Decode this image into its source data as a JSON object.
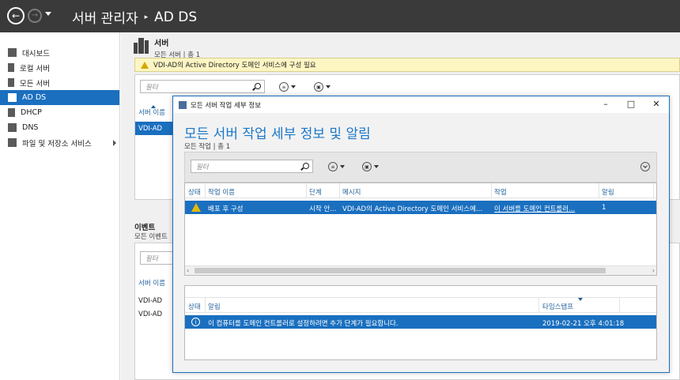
{
  "titlebar": {
    "breadcrumb_app": "서버 관리자",
    "breadcrumb_page": "AD DS"
  },
  "sidebar": {
    "items": [
      {
        "label": "대시보드",
        "icon": "dashboard-icon"
      },
      {
        "label": "로컬 서버",
        "icon": "local-server-icon"
      },
      {
        "label": "모든 서버",
        "icon": "all-servers-icon"
      },
      {
        "label": "AD DS",
        "icon": "ad-ds-icon",
        "active": true
      },
      {
        "label": "DHCP",
        "icon": "dhcp-icon"
      },
      {
        "label": "DNS",
        "icon": "dns-icon"
      },
      {
        "label": "파일 및 저장소 서비스",
        "icon": "file-storage-icon"
      }
    ]
  },
  "servers": {
    "title": "서버",
    "subtitle": "모든 서버 | 총 1",
    "warning": "VDI-AD의 Active Directory 도메인 서비스에 구성 필요",
    "filter_placeholder": "필터",
    "col_server_name": "서버 이름",
    "row_server": "VDI-AD"
  },
  "events": {
    "title": "이벤트",
    "subtitle": "모든 이벤트",
    "filter_placeholder": "필터",
    "col_server_name": "서버 이름",
    "rows": [
      "VDI-AD",
      "VDI-AD"
    ]
  },
  "dialog": {
    "window_title": "모든 서버 작업 세부 정보",
    "heading": "모든 서버 작업 세부 정보 및 알림",
    "subtitle": "모든 작업 | 총 1",
    "filter_placeholder": "필터",
    "tasks": {
      "headers": {
        "status": "상태",
        "task_name": "작업 이름",
        "stage": "단계",
        "message": "메시지",
        "action": "작업",
        "notifications": "알림"
      },
      "row": {
        "task_name": "배포 후 구성",
        "stage": "시작 안...",
        "message": "VDI-AD의 Active Directory 도메인 서비스에...",
        "action": "이 서버를 도메인 컨트롤러...",
        "notifications": "1"
      }
    },
    "notifications": {
      "headers": {
        "status": "상태",
        "notification": "알림",
        "timestamp": "타임스탬프"
      },
      "row": {
        "message": "이 컴퓨터를 도메인 컨트롤러로 설정하려면 추가 단계가 필요합니다.",
        "timestamp": "2019-02-21 오후 4:01:18"
      }
    }
  },
  "colors": {
    "accent": "#1a6fbf",
    "titlebar": "#3a3a3a",
    "heading_blue": "#1a77c9",
    "warning_bg": "#fdf6c3"
  }
}
